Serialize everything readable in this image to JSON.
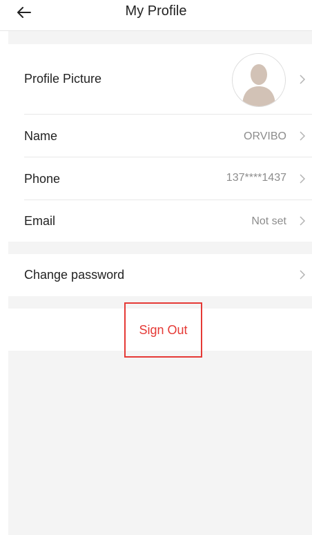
{
  "header": {
    "title": "My Profile",
    "back_icon": "arrow-left-icon"
  },
  "profile": {
    "picture_label": "Profile Picture",
    "name_label": "Name",
    "name_value": "ORVIBO",
    "phone_label": "Phone",
    "phone_value": "137****1437",
    "email_label": "Email",
    "email_value": "Not set"
  },
  "security": {
    "change_password_label": "Change password"
  },
  "actions": {
    "sign_out_label": "Sign Out"
  },
  "colors": {
    "accent_red": "#e53935",
    "background_gray": "#f4f4f4",
    "text_primary": "#222222",
    "text_secondary": "#8c8c8c"
  },
  "icons": {
    "chevron": "chevron-right-icon",
    "avatar": "default-avatar-icon"
  }
}
